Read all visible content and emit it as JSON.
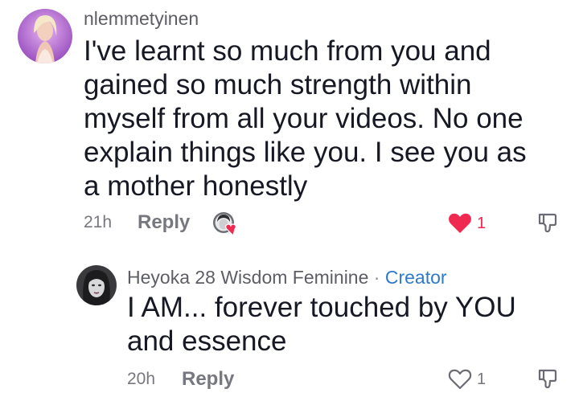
{
  "comments": [
    {
      "username": "nlemmetyinen",
      "text_lines": [
        "I've learnt so much from you and",
        "gained so much strength within",
        "myself from all your videos. No one",
        "explain things like you. I see you as",
        "a mother honestly"
      ],
      "time": "21h",
      "reply_label": "Reply",
      "like_count": "1",
      "liked": true,
      "liked_by_creator": true
    },
    {
      "username": "Heyoka 28 Wisdom Feminine",
      "separator": "·",
      "badge": "Creator",
      "text_lines": [
        "I AM... forever touched by YOU",
        "and essence"
      ],
      "time": "20h",
      "reply_label": "Reply",
      "like_count": "1",
      "liked": false
    }
  ],
  "colors": {
    "like_active": "#ef2950",
    "creator_badge": "#2f79c9",
    "muted_text": "#77777f"
  },
  "icons": [
    "heart-filled-icon",
    "heart-outline-icon",
    "dislike-icon",
    "creator-liked-avatar-icon"
  ]
}
